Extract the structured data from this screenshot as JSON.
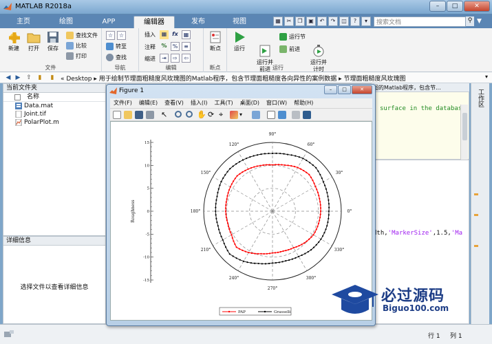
{
  "window": {
    "title": "MATLAB R2018a"
  },
  "tabs": [
    {
      "label": "主页",
      "active": false
    },
    {
      "label": "绘图",
      "active": false
    },
    {
      "label": "APP",
      "active": false
    },
    {
      "label": "编辑器",
      "active": true
    },
    {
      "label": "发布",
      "active": false
    },
    {
      "label": "视图",
      "active": false
    }
  ],
  "search": {
    "placeholder": "搜索文档"
  },
  "ribbon": {
    "file_group": {
      "label": "文件",
      "new": "新建",
      "open": "打开",
      "save": "保存",
      "find_file": "查找文件",
      "compare": "比较",
      "print": "打印"
    },
    "nav_group": {
      "label": "导航",
      "goto": "转至",
      "find": "查找"
    },
    "edit_group": {
      "label": "编辑",
      "insert": "插入",
      "comment": "注释",
      "indent": "缩进"
    },
    "breakpoint_group": {
      "label": "断点",
      "breakpoints": "断点"
    },
    "run_group": {
      "label": "运行",
      "run": "运行",
      "run_advance": "运行并\n前进",
      "run_section": "运行节",
      "advance": "前进",
      "run_time": "运行并\n计时"
    }
  },
  "address": {
    "path": "« Desktop ▸ 用于绘制节理面粗糙度风玫瑰图的Matlab程序，包含节理面粗糙度各向异性的案例数据 ▸ 节理面粗糙度风玫瑰图"
  },
  "current_folder": {
    "title": "当前文件夹",
    "column": "名称",
    "files": [
      "Data.mat",
      "Joint.tif",
      "PolarPlot.m"
    ]
  },
  "details": {
    "title": "详细信息",
    "hint": "选择文件以查看详细信息"
  },
  "editor": {
    "tab_label": "图的Matlab程序，包含节...",
    "code_line_1": "surface in the database",
    "code_line_2_prefix": "dth,",
    "code_line_2_str1": "'MarkerSize'",
    "code_line_2_mid": ",1.5,",
    "code_line_2_str2": "'Ma"
  },
  "right_dock": {
    "label": "工作区"
  },
  "status": {
    "row_label": "行",
    "row": "1",
    "col_label": "列",
    "col": "1"
  },
  "figure": {
    "title": "Figure 1",
    "menu": [
      "文件(F)",
      "编辑(E)",
      "查看(V)",
      "插入(I)",
      "工具(T)",
      "桌面(D)",
      "窗口(W)",
      "帮助(H)"
    ]
  },
  "chart_data": {
    "type": "polar-line",
    "ylabel": "Roughness",
    "angle_ticks": [
      "0°",
      "30°",
      "60°",
      "90°",
      "120°",
      "150°",
      "180°",
      "210°",
      "240°",
      "270°",
      "300°",
      "330°"
    ],
    "radial_ticks": [
      -15,
      -10,
      -5,
      0,
      5,
      10,
      15
    ],
    "rlim": [
      0,
      15
    ],
    "series": [
      {
        "name": "PAP",
        "color": "#ff0000",
        "marker": "dot",
        "angles_deg": [
          0,
          15,
          30,
          45,
          60,
          75,
          90,
          105,
          120,
          135,
          150,
          165,
          180,
          195,
          210,
          225,
          240,
          255,
          270,
          285,
          300,
          315,
          330,
          345
        ],
        "r": [
          10.5,
          10.6,
          10.8,
          11.3,
          11.0,
          10.4,
          10.1,
          10.3,
          10.6,
          10.9,
          10.6,
          10.3,
          10.2,
          10.1,
          10.3,
          11.1,
          10.4,
          9.6,
          9.1,
          9.0,
          9.2,
          9.8,
          10.3,
          10.4
        ]
      },
      {
        "name": "Grasselli",
        "color": "#000000",
        "marker": "dot",
        "angles_deg": [
          0,
          15,
          30,
          45,
          60,
          75,
          90,
          105,
          120,
          135,
          150,
          165,
          180,
          195,
          210,
          225,
          240,
          255,
          270,
          285,
          300,
          315,
          330,
          345
        ],
        "r": [
          12.3,
          12.5,
          12.8,
          13.4,
          13.3,
          12.8,
          12.6,
          12.7,
          12.9,
          13.1,
          12.9,
          12.5,
          12.4,
          12.3,
          12.5,
          13.2,
          12.6,
          11.8,
          11.3,
          11.2,
          11.4,
          11.9,
          12.2,
          12.3
        ]
      }
    ],
    "legend_position": "bottom",
    "grid": true
  },
  "watermark": {
    "title": "必过源码",
    "subtitle": "Biguo100.com"
  },
  "colors": {
    "tab_strip": "#5b86b4",
    "ribbon": "#f3f3f3",
    "run_green": "#2ea043"
  }
}
